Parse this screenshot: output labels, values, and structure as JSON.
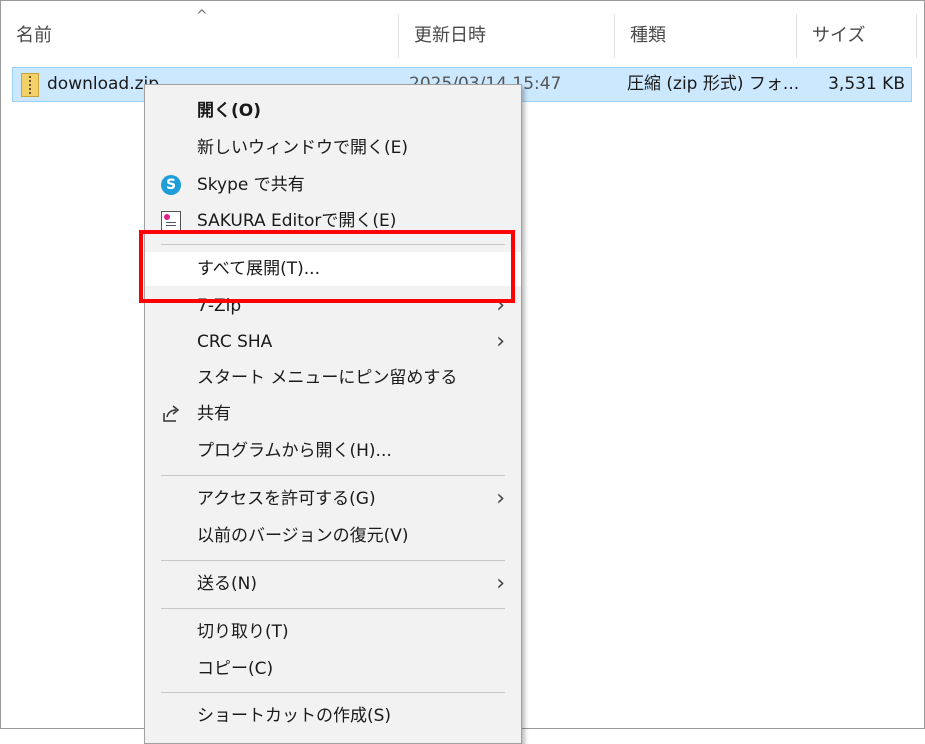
{
  "columns": {
    "name": "名前",
    "date": "更新日時",
    "type": "種類",
    "size": "サイズ",
    "sort_glyph": "^"
  },
  "file": {
    "name": "download.zip",
    "date": "2025/03/14 15:47",
    "type": "圧縮 (zip 形式) フォ...",
    "size": "3,531 KB"
  },
  "menu": {
    "open": "開く(O)",
    "open_new_window": "新しいウィンドウで開く(E)",
    "skype_share": "Skype で共有",
    "skype_glyph": "S",
    "sakura_open": "SAKURA Editorで開く(E)",
    "extract_all": "すべて展開(T)...",
    "seven_zip": "7-Zip",
    "crc_sha": "CRC SHA",
    "pin_start": "スタート メニューにピン留めする",
    "share": "共有",
    "open_with": "プログラムから開く(H)...",
    "give_access": "アクセスを許可する(G)",
    "restore_previous": "以前のバージョンの復元(V)",
    "send_to": "送る(N)",
    "cut": "切り取り(T)",
    "copy": "コピー(C)",
    "create_shortcut": "ショートカットの作成(S)",
    "submenu_glyph": "›"
  },
  "icons": {
    "file": "zip-folder-icon",
    "skype": "skype-icon",
    "sakura": "sakura-editor-icon",
    "share": "share-icon"
  },
  "colors": {
    "selection": "#cce8ff",
    "highlight": "#ff0000",
    "menu_bg": "#f2f2f2"
  }
}
